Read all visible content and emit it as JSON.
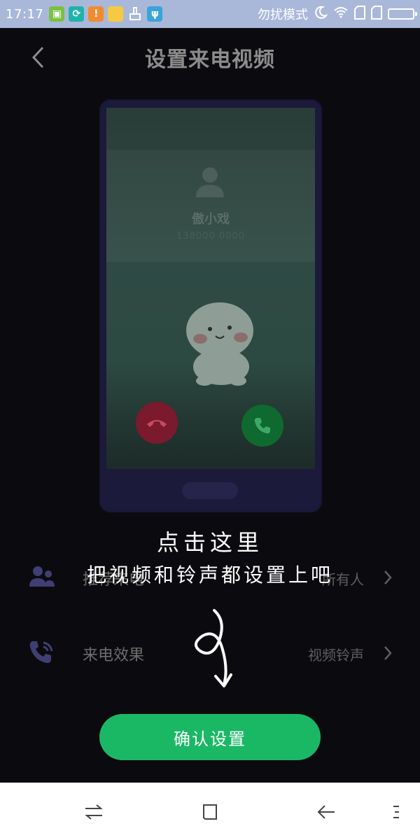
{
  "status_bar": {
    "time": "17:17",
    "dnd_label": "勿扰模式",
    "icons": [
      "app-store-icon",
      "sync-icon",
      "warning-icon",
      "folder-icon",
      "brush-icon",
      "usb-icon",
      "moon-icon",
      "wifi-icon",
      "sim1-icon",
      "sim2-icon",
      "battery-icon"
    ]
  },
  "header": {
    "title": "设置来电视频",
    "back_icon": "chevron-left-icon"
  },
  "preview": {
    "caller_name": "傲小戏",
    "caller_number": "138000 0000",
    "decline_color": "#7a1a2c",
    "accept_color": "#0f6a2f"
  },
  "settings": {
    "rows": [
      {
        "label": "推荐来电",
        "value": "所有人",
        "icon": "contacts-icon"
      },
      {
        "label": "来电效果",
        "value": "视频铃声",
        "icon": "ringing-phone-icon"
      }
    ]
  },
  "guide": {
    "line1": "点击这里",
    "line2": "把视频和铃声都设置上吧"
  },
  "confirm_button": {
    "label": "确认设置",
    "color": "#1ab865"
  },
  "nav": {
    "buttons": [
      "switch-icon",
      "home-icon",
      "back-icon",
      "menu-icon"
    ]
  }
}
